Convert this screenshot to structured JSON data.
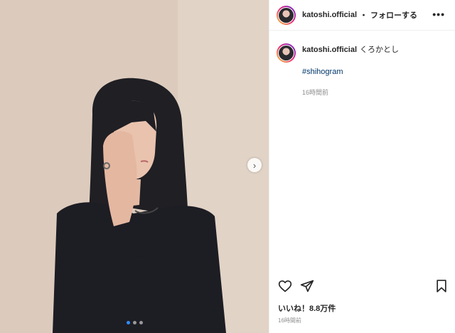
{
  "post": {
    "username": "katoshi.official",
    "separator": "・",
    "follow_label": "フォローする",
    "more_label": "•••",
    "caption_text": "くろかとし",
    "hashtag": "#shihogram",
    "caption_time": "16時間前",
    "likes": "いいね！8.8万件",
    "posted_time": "16時間前",
    "next_label": "›",
    "carousel_dots": 3,
    "active_dot": 0,
    "icons": [
      "heart-icon",
      "share-icon",
      "bookmark-icon",
      "chevron-right-icon"
    ],
    "colors": {
      "link": "#00376b",
      "muted": "#8e8e8e",
      "active_dot": "#2f8cff"
    }
  }
}
